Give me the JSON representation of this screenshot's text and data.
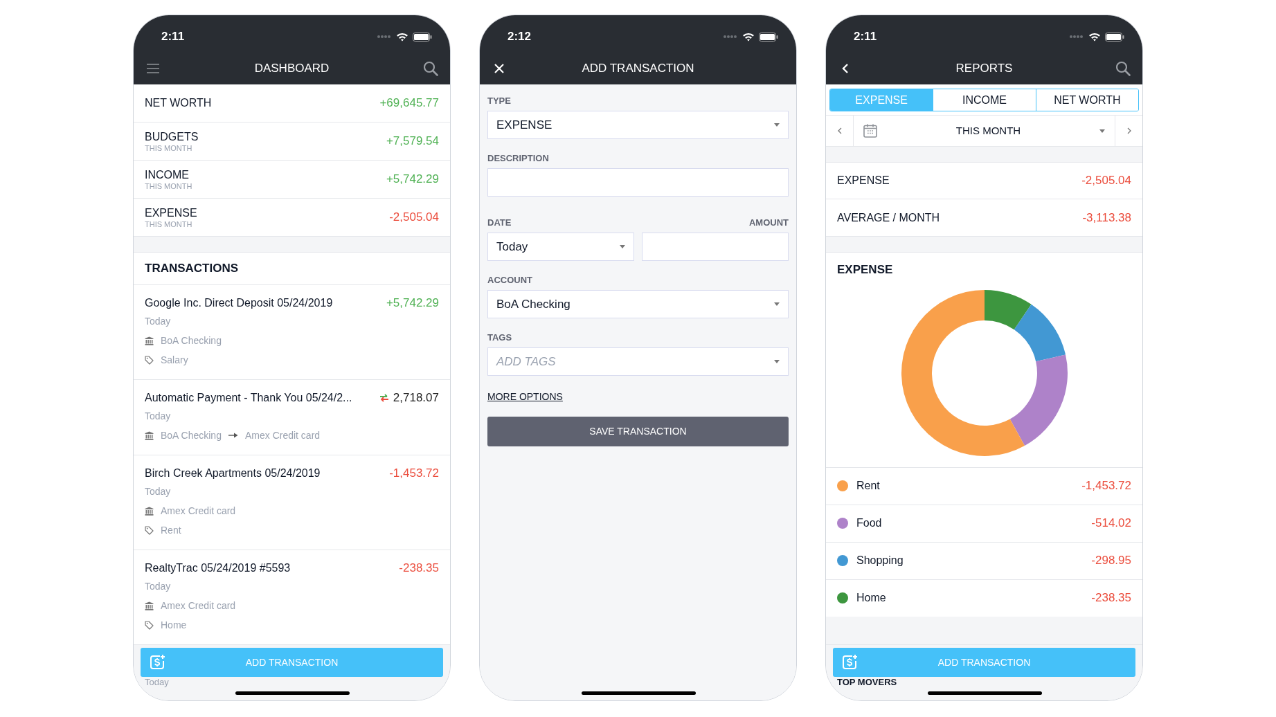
{
  "dashboard": {
    "status_time": "2:11",
    "title": "DASHBOARD",
    "summary": [
      {
        "label": "NET WORTH",
        "value": "+69,645.77",
        "color": "#4fb153"
      },
      {
        "label": "BUDGETS",
        "sublabel": "THIS MONTH",
        "value": "+7,579.54",
        "color": "#4fb153"
      },
      {
        "label": "INCOME",
        "sublabel": "THIS MONTH",
        "value": "+5,742.29",
        "color": "#4fb153"
      },
      {
        "label": "EXPENSE",
        "sublabel": "THIS MONTH",
        "value": "-2,505.04",
        "color": "#eb4d3d"
      }
    ],
    "section_title": "TRANSACTIONS",
    "transactions": [
      {
        "kind": "regular",
        "description": "Google Inc. Direct Deposit 05/24/2019",
        "amount": "+5,742.29",
        "color": "#4fb153",
        "date": "Today",
        "details": [
          {
            "kind": "account",
            "text": "BoA Checking"
          },
          {
            "kind": "tag",
            "text": "Salary"
          }
        ]
      },
      {
        "kind": "transfer",
        "description": "Automatic Payment - Thank You 05/24/2...",
        "amount": "2,718.07",
        "color": "#222222",
        "date": "Today",
        "details": [
          {
            "kind": "transfer",
            "from": "BoA Checking",
            "to": "Amex Credit card"
          }
        ]
      },
      {
        "kind": "regular",
        "description": "Birch Creek Apartments 05/24/2019",
        "amount": "-1,453.72",
        "color": "#eb4d3d",
        "date": "Today",
        "details": [
          {
            "kind": "account",
            "text": "Amex Credit card"
          },
          {
            "kind": "tag",
            "text": "Rent"
          }
        ]
      },
      {
        "kind": "regular",
        "description": "RealtyTrac 05/24/2019 #5593",
        "amount": "-238.35",
        "color": "#eb4d3d",
        "date": "Today",
        "details": [
          {
            "kind": "account",
            "text": "Amex Credit card"
          },
          {
            "kind": "tag",
            "text": "Home"
          }
        ]
      }
    ],
    "add_button": "ADD TRANSACTION",
    "partial_text": "Today"
  },
  "add_transaction": {
    "status_time": "2:12",
    "title": "ADD TRANSACTION",
    "type": {
      "label": "TYPE",
      "value": "EXPENSE"
    },
    "description": {
      "label": "DESCRIPTION"
    },
    "date": {
      "label": "DATE",
      "value": "Today"
    },
    "amount": {
      "label": "AMOUNT"
    },
    "account": {
      "label": "ACCOUNT",
      "value": "BoA Checking"
    },
    "tags": {
      "label": "TAGS",
      "placeholder": "ADD TAGS"
    },
    "more_options": "MORE OPTIONS",
    "save_button": "SAVE TRANSACTION"
  },
  "reports": {
    "status_time": "2:11",
    "title": "REPORTS",
    "tabs": [
      {
        "label": "EXPENSE",
        "selected": true
      },
      {
        "label": "INCOME",
        "selected": false
      },
      {
        "label": "NET WORTH",
        "selected": false
      }
    ],
    "period": "THIS MONTH",
    "stats": [
      {
        "label": "EXPENSE",
        "value": "-2,505.04"
      },
      {
        "label": "AVERAGE / MONTH",
        "value": "-3,113.38"
      }
    ],
    "chart_data": {
      "type": "donut",
      "title": "EXPENSE",
      "categories": [
        "Rent",
        "Food",
        "Shopping",
        "Home"
      ],
      "values": [
        58.03,
        20.52,
        11.93,
        9.52
      ]
    },
    "legend": [
      {
        "value": "-1,453.72",
        "color": "#f9a04b"
      },
      {
        "value": "-514.02",
        "color": "#ae82c9"
      },
      {
        "value": "-298.95",
        "color": "#4298d3"
      },
      {
        "value": "-238.35",
        "color": "#3d963f"
      }
    ],
    "add_button": "ADD TRANSACTION",
    "partial_text": "TOP MOVERS"
  }
}
